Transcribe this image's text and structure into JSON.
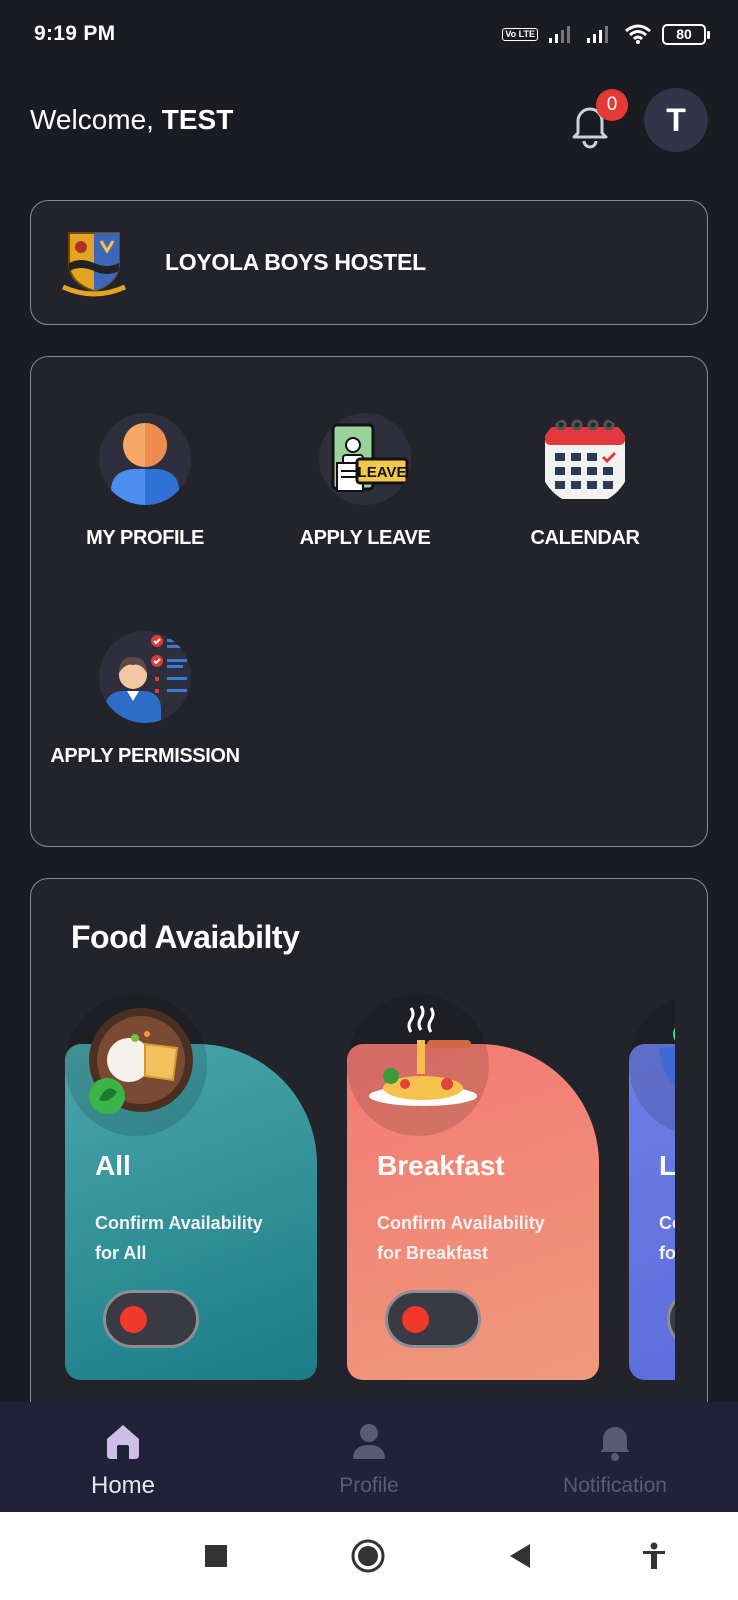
{
  "status_bar": {
    "time": "9:19 PM",
    "network_badge": "Vo LTE",
    "battery": "80"
  },
  "header": {
    "welcome_prefix": "Welcome, ",
    "user_name": "TEST",
    "notification_count": "0",
    "avatar_initial": "T"
  },
  "hostel": {
    "name": "LOYOLA BOYS HOSTEL"
  },
  "menu": {
    "items": [
      {
        "label": "MY PROFILE",
        "icon": "profile-icon"
      },
      {
        "label": "APPLY LEAVE",
        "icon": "leave-icon",
        "icon_text": "LEAVE"
      },
      {
        "label": "CALENDAR",
        "icon": "calendar-icon"
      },
      {
        "label": "APPLY PERMISSION",
        "icon": "permission-icon"
      }
    ]
  },
  "food": {
    "title": "Food Avaiabilty",
    "tiles": [
      {
        "name": "All",
        "desc_line1": "Confirm Availability",
        "desc_line2": "for All",
        "enabled": false,
        "color": "#2f9199"
      },
      {
        "name": "Breakfast",
        "desc_line1": "Confirm Availability",
        "desc_line2": "for Breakfast",
        "enabled": false,
        "color": "#f2857a"
      },
      {
        "name": "Lu",
        "desc_line1": "Con",
        "desc_line2": "for l",
        "enabled": false,
        "color": "#6677e0"
      }
    ]
  },
  "bottom_nav": {
    "items": [
      {
        "label": "Home",
        "icon": "home-icon",
        "active": true
      },
      {
        "label": "Profile",
        "icon": "person-icon",
        "active": false
      },
      {
        "label": "Notification",
        "icon": "bell-icon",
        "active": false
      }
    ]
  },
  "colors": {
    "background": "#1b1b22",
    "card": "#23232b",
    "nav": "#22213a",
    "badge": "#e53935",
    "toggle_knob": "#f0382b"
  }
}
